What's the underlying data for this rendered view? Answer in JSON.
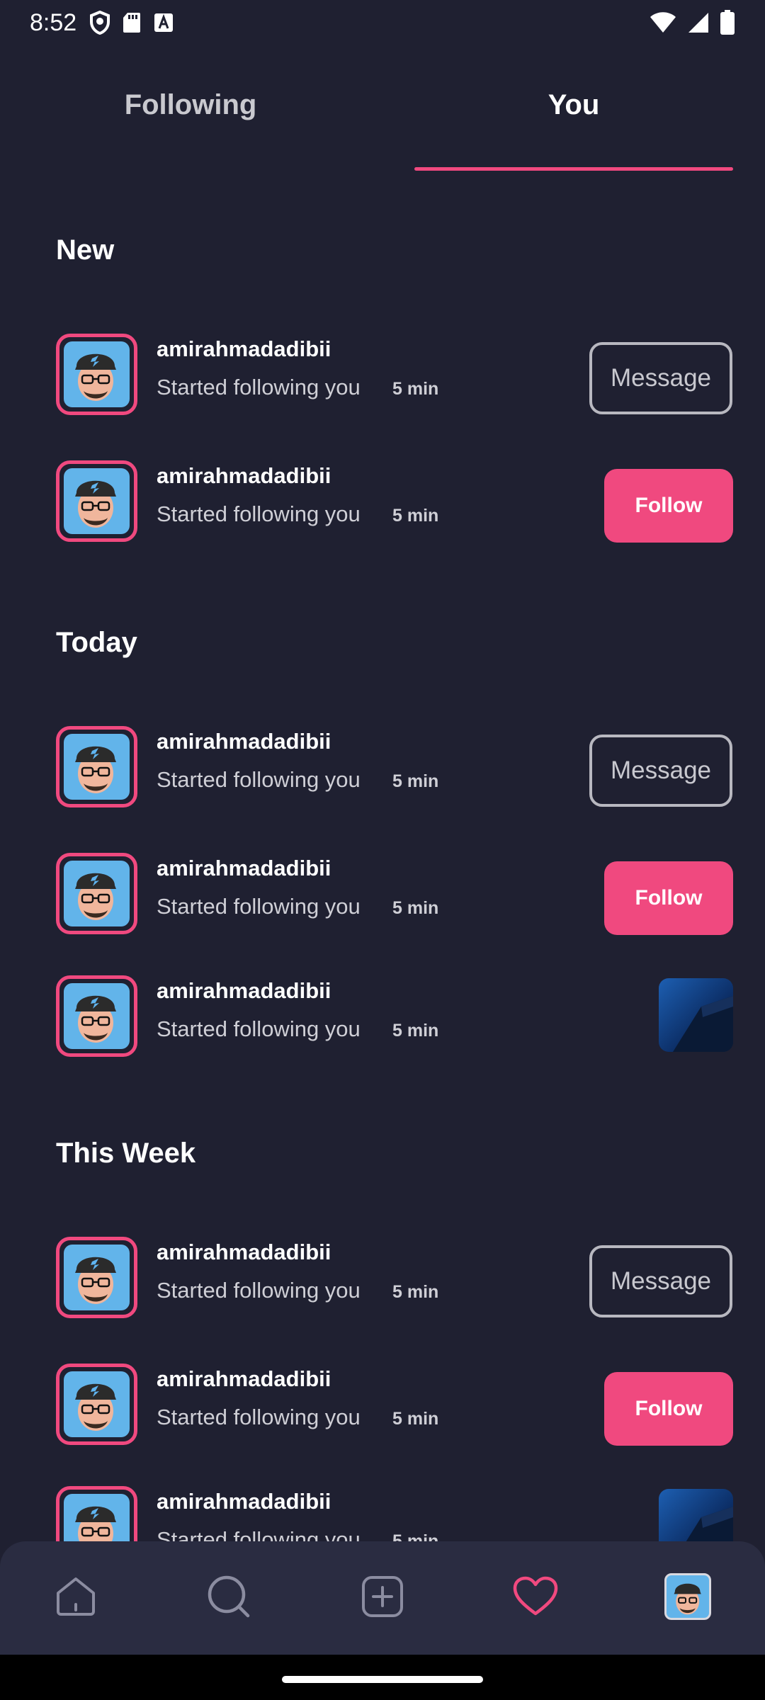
{
  "status_bar": {
    "time": "8:52",
    "left_icons": [
      "shield-icon",
      "sd-card-icon",
      "keyboard-a-icon"
    ],
    "right_icons": [
      "wifi-icon",
      "signal-icon",
      "battery-icon"
    ]
  },
  "tabs": [
    {
      "label": "Following",
      "active": false
    },
    {
      "label": "You",
      "active": true
    }
  ],
  "colors": {
    "background": "#1f2031",
    "accent": "#f0497f",
    "nav_background": "#2a2c41"
  },
  "sections": [
    {
      "title": "New",
      "items": [
        {
          "username": "amirahmadadibii",
          "activity": "Started following you",
          "time": "5 min",
          "action": "Message"
        },
        {
          "username": "amirahmadadibii",
          "activity": "Started following you",
          "time": "5 min",
          "action": "Follow"
        }
      ]
    },
    {
      "title": "Today",
      "items": [
        {
          "username": "amirahmadadibii",
          "activity": "Started following you",
          "time": "5 min",
          "action": "Message"
        },
        {
          "username": "amirahmadadibii",
          "activity": "Started following you",
          "time": "5 min",
          "action": "Follow"
        },
        {
          "username": "amirahmadadibii",
          "activity": "Started following you",
          "time": "5 min",
          "action": "post-thumbnail"
        }
      ]
    },
    {
      "title": "This Week",
      "items": [
        {
          "username": "amirahmadadibii",
          "activity": "Started following you",
          "time": "5 min",
          "action": "Message"
        },
        {
          "username": "amirahmadadibii",
          "activity": "Started following you",
          "time": "5 min",
          "action": "Follow"
        },
        {
          "username": "amirahmadadibii",
          "activity": "Started following you",
          "time": "5 min",
          "action": "post-thumbnail"
        }
      ]
    }
  ],
  "bottom_nav": [
    {
      "icon": "home-icon",
      "active": false
    },
    {
      "icon": "search-icon",
      "active": false
    },
    {
      "icon": "add-post-icon",
      "active": false
    },
    {
      "icon": "heart-icon",
      "active": true
    },
    {
      "icon": "profile-avatar",
      "active": false
    }
  ]
}
